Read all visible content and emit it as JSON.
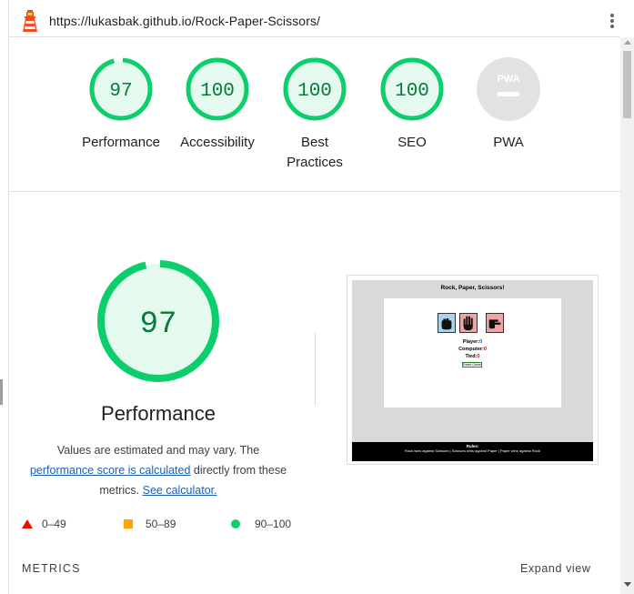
{
  "header": {
    "url": "https://lukasbak.github.io/Rock-Paper-Scissors/"
  },
  "categories": [
    {
      "label": "Performance",
      "score": "97",
      "fraction": 0.97
    },
    {
      "label": "Accessibility",
      "score": "100",
      "fraction": 1.0
    },
    {
      "label": "Best Practices",
      "score": "100",
      "fraction": 1.0
    },
    {
      "label": "SEO",
      "score": "100",
      "fraction": 1.0
    },
    {
      "label": "PWA",
      "badge": "PWA"
    }
  ],
  "performance": {
    "score": "97",
    "fraction": 0.97,
    "title": "Performance",
    "desc_prefix": "Values are estimated and may vary. The",
    "desc_link": "performance score is calculated",
    "desc_middle": "directly from these metrics.",
    "desc_link2": "See calculator."
  },
  "legend": [
    {
      "range": "0–49",
      "color": "#eb0f00"
    },
    {
      "range": "50–89",
      "color": "#ffa400"
    },
    {
      "range": "90–100",
      "color": "#0cce6b"
    }
  ],
  "screenshot": {
    "title": "Rock, Paper, Scissors!",
    "player_label": "Player:",
    "player_value": "0",
    "computer_label": "Computer:",
    "computer_value": "0",
    "tied_label": "Tied:",
    "tied_value": "0",
    "button_label": "Reset Game",
    "footer_title": "Rules:",
    "footer_text": "Rock wins against Scissors | Scissors wins against Paper | Paper wins against Rock"
  },
  "metrics": {
    "label": "METRICS",
    "expand": "Expand view"
  },
  "colors": {
    "pass": "#0cce6b",
    "pass_fill": "#e5faef",
    "pass_text": "#0a7a3c",
    "link": "#1a5fb4"
  }
}
